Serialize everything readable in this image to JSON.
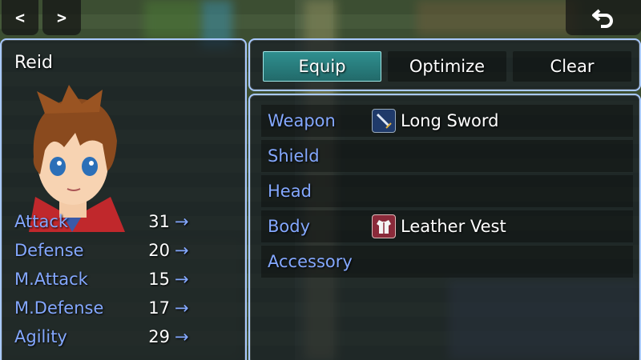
{
  "nav": {
    "prev": "<",
    "next": ">",
    "back_icon": "back-arrow-icon"
  },
  "actor": {
    "name": "Reid",
    "params": [
      {
        "name": "Attack",
        "value": "31",
        "arrow": "→"
      },
      {
        "name": "Defense",
        "value": "20",
        "arrow": "→"
      },
      {
        "name": "M.Attack",
        "value": "15",
        "arrow": "→"
      },
      {
        "name": "M.Defense",
        "value": "17",
        "arrow": "→"
      },
      {
        "name": "Agility",
        "value": "29",
        "arrow": "→"
      }
    ]
  },
  "commands": {
    "equip": "Equip",
    "optimize": "Optimize",
    "clear": "Clear"
  },
  "slots": [
    {
      "name": "Weapon",
      "item": "Long Sword",
      "icon": "sword-icon"
    },
    {
      "name": "Shield",
      "item": ""
    },
    {
      "name": "Head",
      "item": ""
    },
    {
      "name": "Body",
      "item": "Leather Vest",
      "icon": "vest-icon"
    },
    {
      "name": "Accessory",
      "item": ""
    }
  ],
  "colors": {
    "system_blue": "#84a8ff",
    "selected_teal": "#2f8f8f",
    "window_border": "#a9c9ff"
  }
}
